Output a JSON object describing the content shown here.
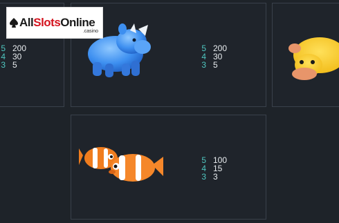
{
  "brand": {
    "logo_main": "AllSlotsOnline",
    "logo_all": "All",
    "logo_slots": "Slots",
    "logo_online": "Online",
    "logo_tld": ".casino"
  },
  "symbols": [
    {
      "name": "rhino",
      "payouts": [
        {
          "count": "5",
          "value": "200"
        },
        {
          "count": "4",
          "value": "30"
        },
        {
          "count": "3",
          "value": "5"
        }
      ]
    },
    {
      "name": "left-cut-symbol",
      "payouts": [
        {
          "count": "5",
          "value": "200"
        },
        {
          "count": "4",
          "value": "30"
        },
        {
          "count": "3",
          "value": "5"
        }
      ]
    },
    {
      "name": "clownfish",
      "payouts": [
        {
          "count": "5",
          "value": "100"
        },
        {
          "count": "4",
          "value": "15"
        },
        {
          "count": "3",
          "value": "3"
        }
      ]
    }
  ],
  "icons": [
    "rhino-icon",
    "platypus-icon",
    "clownfish-icon"
  ],
  "colors": {
    "background": "#1e2329",
    "count": "#4fc7c0",
    "value": "#e8ecef",
    "border": "#3a414b"
  }
}
